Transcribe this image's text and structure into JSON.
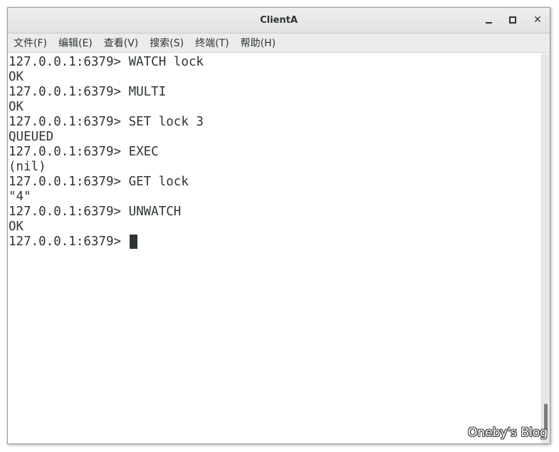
{
  "window": {
    "title": "ClientA",
    "controls": {
      "minimize": "minimize-icon",
      "maximize": "maximize-icon",
      "close_glyph": "✕"
    }
  },
  "menu": [
    {
      "label": "文件(F)"
    },
    {
      "label": "编辑(E)"
    },
    {
      "label": "查看(V)"
    },
    {
      "label": "搜索(S)"
    },
    {
      "label": "终端(T)"
    },
    {
      "label": "帮助(H)"
    }
  ],
  "terminal": {
    "lines": [
      "127.0.0.1:6379> WATCH lock",
      "OK",
      "127.0.0.1:6379> MULTI",
      "OK",
      "127.0.0.1:6379> SET lock 3",
      "QUEUED",
      "127.0.0.1:6379> EXEC",
      "(nil)",
      "127.0.0.1:6379> GET lock",
      "\"4\"",
      "127.0.0.1:6379> UNWATCH",
      "OK"
    ],
    "prompt": "127.0.0.1:6379> "
  },
  "watermark": "Oneby's Blog",
  "colors": {
    "terminal_bg": "#ffffff",
    "terminal_fg": "#2e3436",
    "titlebar_bg": "#e6e6e6",
    "menubar_bg": "#ececec"
  }
}
